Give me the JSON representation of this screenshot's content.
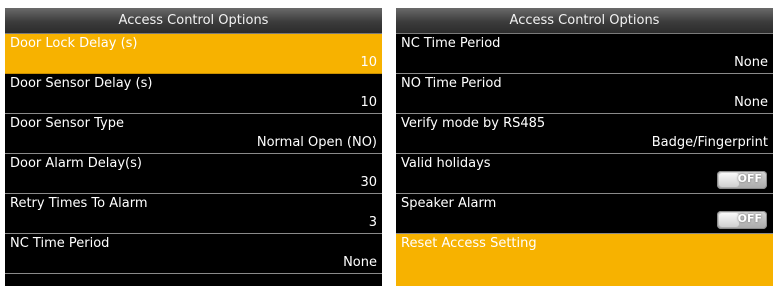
{
  "left": {
    "header": "Access Control Options",
    "items": [
      {
        "label": "Door Lock Delay (s)",
        "value": "10"
      },
      {
        "label": "Door Sensor Delay (s)",
        "value": "10"
      },
      {
        "label": "Door Sensor Type",
        "value": "Normal Open (NO)"
      },
      {
        "label": "Door Alarm Delay(s)",
        "value": "30"
      },
      {
        "label": "Retry Times To Alarm",
        "value": "3"
      },
      {
        "label": "NC Time Period",
        "value": "None"
      }
    ],
    "selected_index": 0
  },
  "right": {
    "header": "Access Control Options",
    "items": [
      {
        "label": "NC Time Period",
        "value": "None"
      },
      {
        "label": "NO Time Period",
        "value": "None"
      },
      {
        "label": "Verify mode by RS485",
        "value": "Badge/Fingerprint"
      },
      {
        "label": "Valid holidays",
        "toggle": "OFF"
      },
      {
        "label": "Speaker Alarm",
        "toggle": "OFF"
      },
      {
        "label": "Reset Access Setting"
      }
    ],
    "selected_index": 5
  },
  "colors": {
    "selected": "#f7b200",
    "background": "#000000",
    "divider": "#8a8a8a"
  }
}
